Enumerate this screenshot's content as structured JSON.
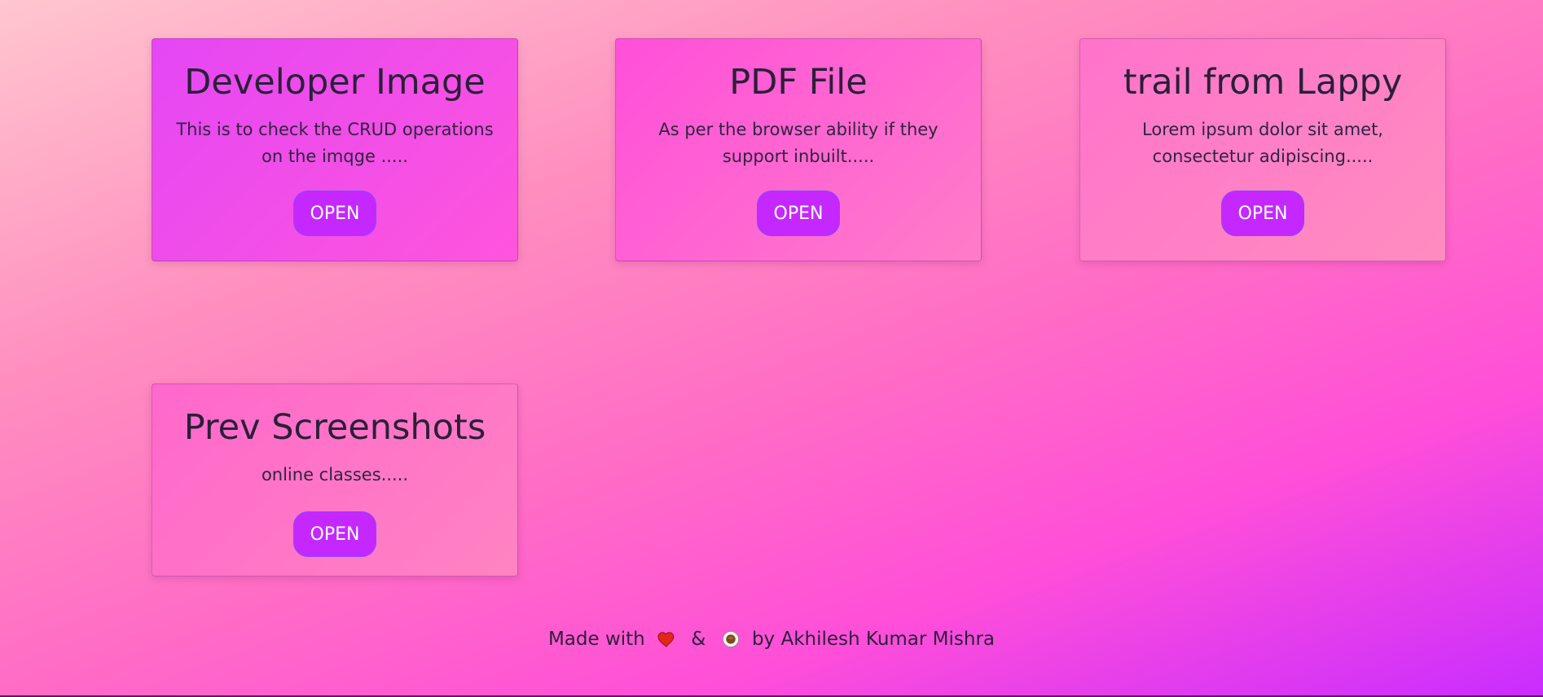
{
  "cards": [
    {
      "title": "Developer Image",
      "text": "This is to check the CRUD operations on the imqge .....",
      "button": "OPEN"
    },
    {
      "title": "PDF File",
      "text": "As per the browser ability if they support inbuilt.....",
      "button": "OPEN"
    },
    {
      "title": "trail from Lappy",
      "text": "Lorem ipsum dolor sit amet, consectetur adipiscing.....",
      "button": "OPEN"
    },
    {
      "title": "Prev Screenshots",
      "text": "online classes.....",
      "button": "OPEN"
    }
  ],
  "footer": {
    "made_with": "Made with",
    "amp": "&",
    "by_text": "by Akhilesh Kumar Mishra",
    "icons": [
      "heart-icon",
      "coffee-icon"
    ]
  },
  "colors": {
    "button": "#c428ff",
    "button_border": "#8b46ff",
    "text": "#2b1f3a"
  }
}
